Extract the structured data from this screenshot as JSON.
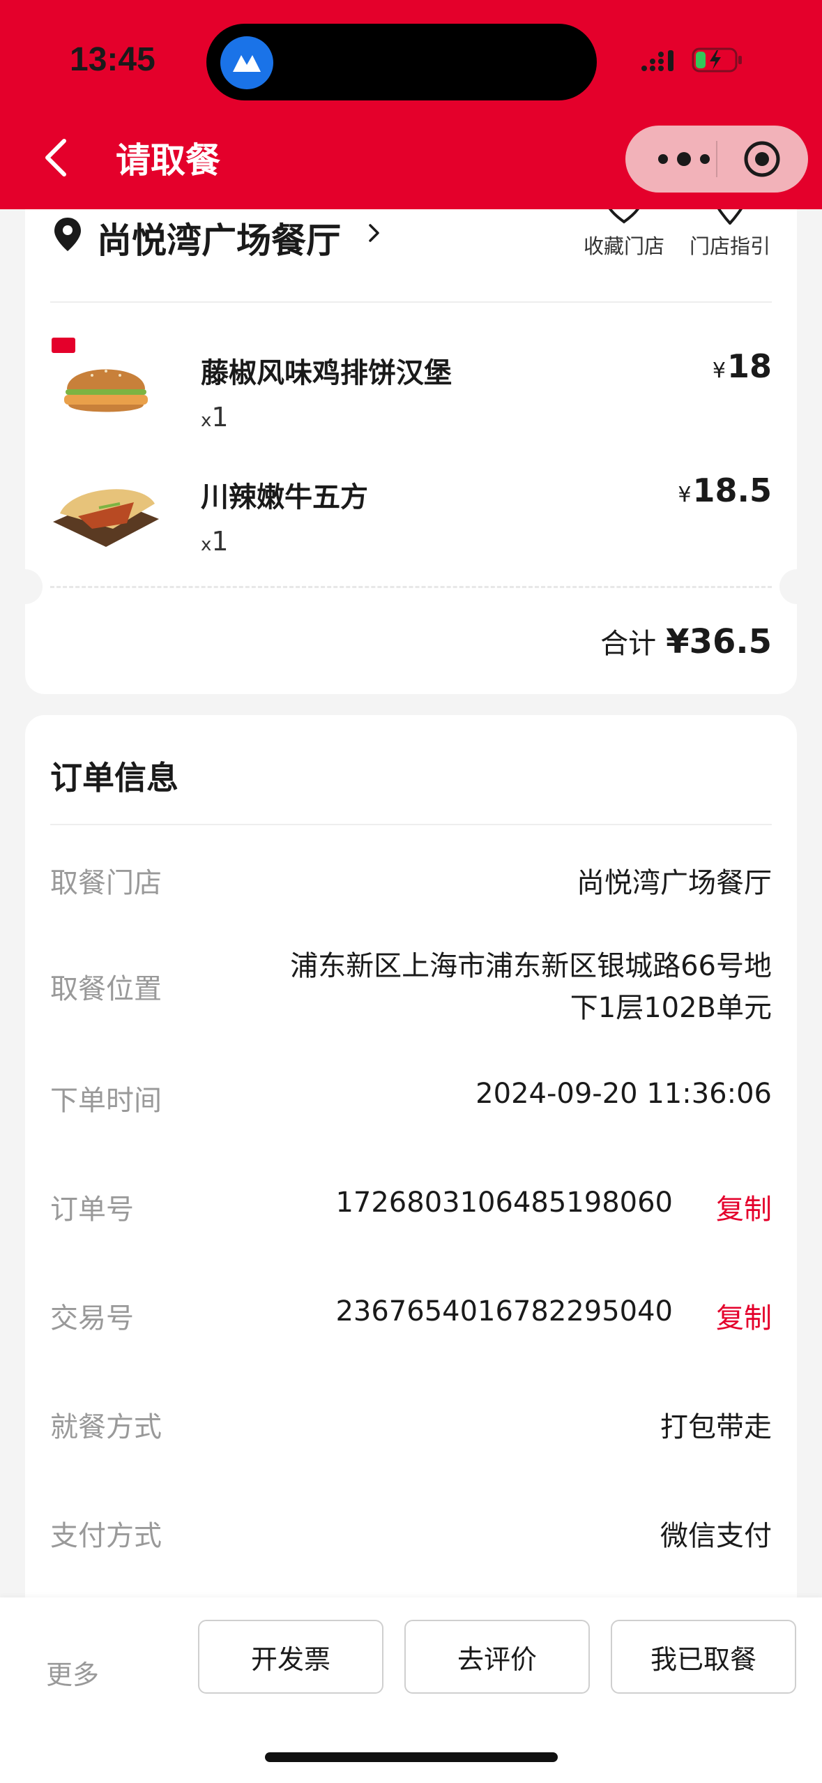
{
  "status_bar": {
    "time": "13:45"
  },
  "nav": {
    "title": "请取餐"
  },
  "store": {
    "name": "尚悦湾广场餐厅",
    "actions": [
      {
        "label": "收藏门店",
        "icon": "heart-icon"
      },
      {
        "label": "门店指引",
        "icon": "location-pin-icon"
      }
    ]
  },
  "order_items": [
    {
      "name": "藤椒风味鸡排饼汉堡",
      "qty_prefix": "x",
      "qty": "1",
      "currency": "¥",
      "price": "18"
    },
    {
      "name": "川辣嫩牛五方",
      "qty_prefix": "x",
      "qty": "1",
      "currency": "¥",
      "price": "18.5"
    }
  ],
  "total": {
    "label": "合计",
    "amount": "¥36.5"
  },
  "order_info": {
    "heading": "订单信息",
    "rows": [
      {
        "key": "取餐门店",
        "value": "尚悦湾广场餐厅"
      },
      {
        "key": "取餐位置",
        "value_line1": "浦东新区上海市浦东新区银城路66号地",
        "value_line2": "下1层102B单元"
      },
      {
        "key": "下单时间",
        "value": "2024-09-20 11:36:06"
      },
      {
        "key": "订单号",
        "value": "1726803106485198060",
        "action": "复制"
      },
      {
        "key": "交易号",
        "value": "2367654016782295040",
        "action": "复制"
      },
      {
        "key": "就餐方式",
        "value": "打包带走"
      },
      {
        "key": "支付方式",
        "value": "微信支付"
      }
    ]
  },
  "bottom_bar": {
    "more": "更多",
    "buttons": [
      "开发票",
      "去评价",
      "我已取餐"
    ]
  },
  "colors": {
    "brand": "#e4002b",
    "copy_text": "#e4002b"
  }
}
